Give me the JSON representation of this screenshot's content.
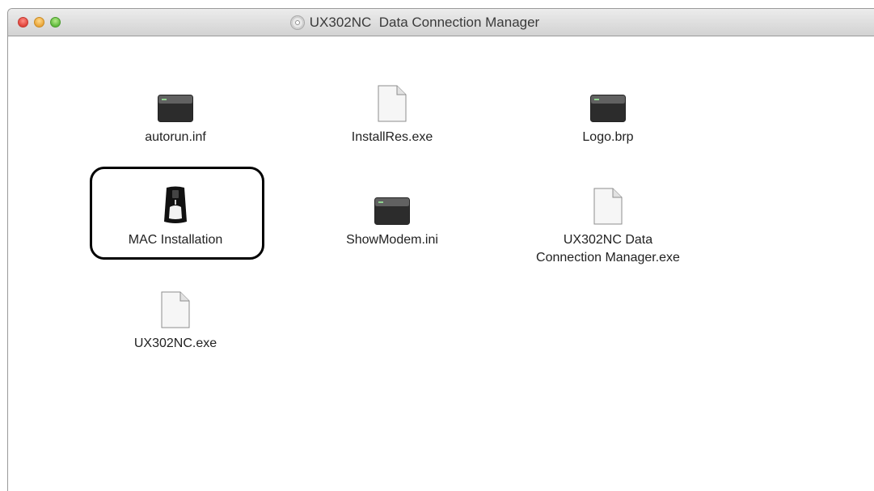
{
  "window": {
    "title": "UX302NC  Data Connection Manager",
    "title_icon": "cd-disc-icon"
  },
  "files": [
    {
      "name": "autorun.inf",
      "icon": "terminal-document-icon"
    },
    {
      "name": "InstallRes.exe",
      "icon": "blank-document-icon"
    },
    {
      "name": "Logo.brp",
      "icon": "terminal-document-icon"
    },
    {
      "name": "MAC Installation",
      "icon": "usb-modem-app-icon"
    },
    {
      "name": "ShowModem.ini",
      "icon": "terminal-document-icon"
    },
    {
      "name_line1": "UX302NC Data",
      "name_line2": "Connection Manager.exe",
      "icon": "blank-document-icon"
    },
    {
      "name": "UX302NC.exe",
      "icon": "blank-document-icon"
    }
  ],
  "highlight": {
    "target": "MAC Installation",
    "color": "#000000"
  }
}
